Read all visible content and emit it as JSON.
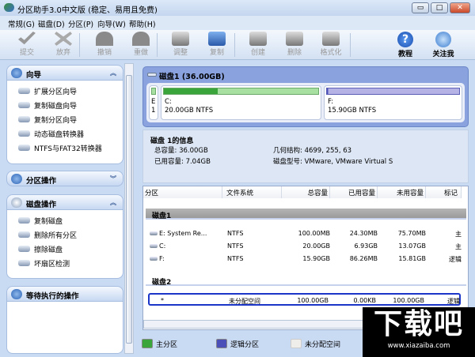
{
  "window": {
    "title": "分区助手3.0中文版 (稳定、易用且免费)",
    "min": "▭",
    "max": "□",
    "close": "✕"
  },
  "menu": [
    "常规(G)",
    "磁盘(D)",
    "分区(P)",
    "向导(W)",
    "帮助(H)"
  ],
  "toolbar": [
    {
      "label": "提交",
      "icon": "check-icon",
      "enabled": false
    },
    {
      "label": "放弃",
      "icon": "x-icon",
      "enabled": false
    },
    {
      "label": "撤销",
      "icon": "undo-icon",
      "enabled": false
    },
    {
      "label": "重做",
      "icon": "redo-icon",
      "enabled": false
    },
    {
      "label": "调整",
      "icon": "resize-disk-icon",
      "enabled": false
    },
    {
      "label": "复制",
      "icon": "copy-disk-icon",
      "enabled": true
    },
    {
      "label": "创建",
      "icon": "create-disk-icon",
      "enabled": false
    },
    {
      "label": "删除",
      "icon": "delete-disk-icon",
      "enabled": false
    },
    {
      "label": "格式化",
      "icon": "format-disk-icon",
      "enabled": false
    },
    {
      "label": "教程",
      "icon": "help-icon",
      "enabled": true
    },
    {
      "label": "关注我",
      "icon": "follow-icon",
      "enabled": true
    }
  ],
  "left": {
    "wizard": {
      "title": "向导",
      "items": [
        "扩展分区向导",
        "复制磁盘向导",
        "复制分区向导",
        "动态磁盘转换器",
        "NTFS与FAT32转换器"
      ]
    },
    "partition_ops": {
      "title": "分区操作"
    },
    "disk_ops": {
      "title": "磁盘操作",
      "items": [
        "复制磁盘",
        "删除所有分区",
        "擦除磁盘",
        "坏扇区检测"
      ]
    },
    "pending": {
      "title": "等待执行的操作"
    }
  },
  "diskmap": {
    "title": "磁盘1 (36.00GB)",
    "parts": [
      {
        "l1": "E",
        "l2": "1"
      },
      {
        "l1": "C:",
        "l2": "20.00GB NTFS",
        "used_pct": 35
      },
      {
        "l1": "F:",
        "l2": "15.90GB NTFS",
        "used_pct": 1
      }
    ]
  },
  "info": {
    "title": "磁盘 1的信息",
    "total": "总容量: 36.00GB",
    "used": "已用容量: 7.04GB",
    "geometry": "几何结构: 4699, 255, 63",
    "model": "磁盘型号: VMware, VMware Virtual S"
  },
  "table": {
    "headers": [
      "分区",
      "文件系统",
      "总容量",
      "已用容量",
      "未用容量",
      "标记"
    ],
    "groups": [
      {
        "name": "磁盘1",
        "rows": [
          [
            "E:  System Re...",
            "NTFS",
            "100.00MB",
            "24.30MB",
            "75.70MB",
            "主"
          ],
          [
            "C:",
            "NTFS",
            "20.00GB",
            "6.93GB",
            "13.07GB",
            "主"
          ],
          [
            "F:",
            "NTFS",
            "15.90GB",
            "86.26MB",
            "15.81GB",
            "逻辑"
          ]
        ]
      },
      {
        "name": "磁盘2",
        "rows": [
          [
            "*",
            "未分配空间",
            "100.00GB",
            "0.00KB",
            "100.00GB",
            "逻辑"
          ]
        ]
      }
    ]
  },
  "legend": [
    "主分区",
    "逻辑分区",
    "未分配空间"
  ],
  "colors": {
    "primary": "#3aa53a",
    "logical": "#4b4fb8",
    "unallocated": "#f0eeea",
    "selected": "#1a35c8"
  },
  "watermark": {
    "logo": "下载吧",
    "url": "www.xiazaiba.com"
  }
}
